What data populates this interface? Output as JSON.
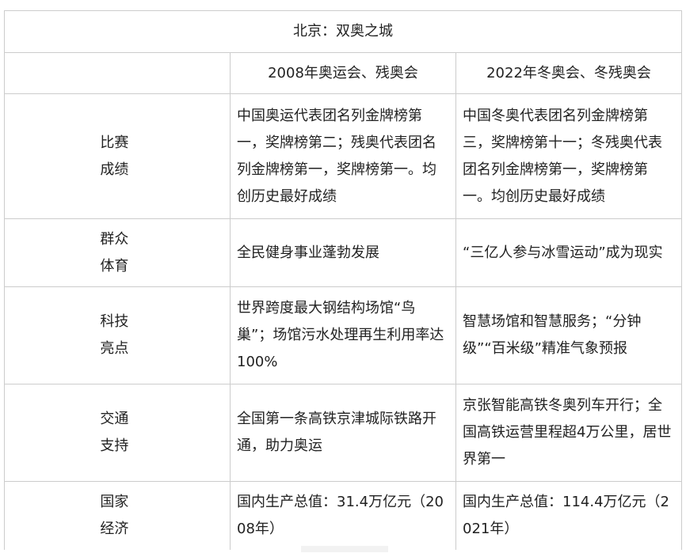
{
  "table": {
    "title": "北京：双奥之城",
    "headers": [
      "",
      "2008年奥运会、残奥会",
      "2022年冬奥会、冬残奥会"
    ],
    "rows": [
      {
        "label": [
          "比赛",
          "成绩"
        ],
        "col2008": "中国奥运代表团名列金牌榜第一，奖牌榜第二；残奥代表团名列金牌榜第一，奖牌榜第一。均创历史最好成绩",
        "col2022": "中国冬奥代表团名列金牌榜第三，奖牌榜第十一；冬残奥代表团名列金牌榜第一，奖牌榜第一。均创历史最好成绩"
      },
      {
        "label": [
          "群众",
          "体育"
        ],
        "col2008": "全民健身事业蓬勃发展",
        "col2022": "“三亿人参与冰雪运动”成为现实"
      },
      {
        "label": [
          "科技",
          "亮点"
        ],
        "col2008": "世界跨度最大钢结构场馆“鸟巢”；场馆污水处理再生利用率达100%",
        "col2022": "智慧场馆和智慧服务；“分钟级”“百米级”精准气象预报"
      },
      {
        "label": [
          "交通",
          "支持"
        ],
        "col2008": "全国第一条高铁京津城际铁路开通，助力奥运",
        "col2022": "京张智能高铁冬奥列车开行；全国高铁运营里程超4万公里，居世界第一"
      },
      {
        "label": [
          "国家",
          "经济"
        ],
        "col2008": "国内生产总值：31.4万亿元（2008年）",
        "col2022": "国内生产总值：114.4万亿元（2021年）"
      }
    ]
  }
}
